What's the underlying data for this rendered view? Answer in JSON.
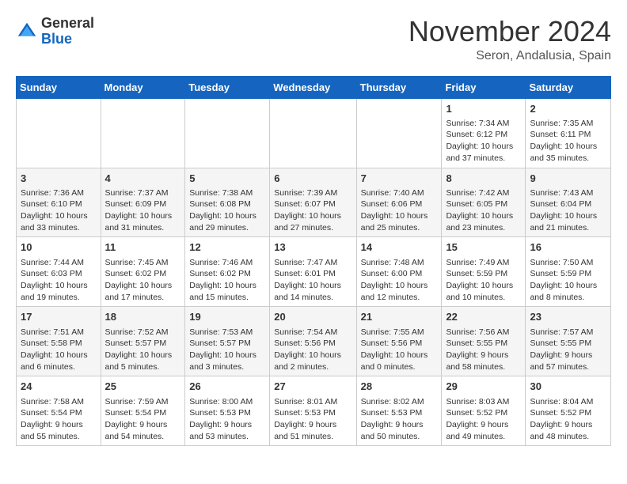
{
  "header": {
    "logo_general": "General",
    "logo_blue": "Blue",
    "month_title": "November 2024",
    "location": "Seron, Andalusia, Spain"
  },
  "weekdays": [
    "Sunday",
    "Monday",
    "Tuesday",
    "Wednesday",
    "Thursday",
    "Friday",
    "Saturday"
  ],
  "weeks": [
    [
      {
        "day": "",
        "content": ""
      },
      {
        "day": "",
        "content": ""
      },
      {
        "day": "",
        "content": ""
      },
      {
        "day": "",
        "content": ""
      },
      {
        "day": "",
        "content": ""
      },
      {
        "day": "1",
        "content": "Sunrise: 7:34 AM\nSunset: 6:12 PM\nDaylight: 10 hours and 37 minutes."
      },
      {
        "day": "2",
        "content": "Sunrise: 7:35 AM\nSunset: 6:11 PM\nDaylight: 10 hours and 35 minutes."
      }
    ],
    [
      {
        "day": "3",
        "content": "Sunrise: 7:36 AM\nSunset: 6:10 PM\nDaylight: 10 hours and 33 minutes."
      },
      {
        "day": "4",
        "content": "Sunrise: 7:37 AM\nSunset: 6:09 PM\nDaylight: 10 hours and 31 minutes."
      },
      {
        "day": "5",
        "content": "Sunrise: 7:38 AM\nSunset: 6:08 PM\nDaylight: 10 hours and 29 minutes."
      },
      {
        "day": "6",
        "content": "Sunrise: 7:39 AM\nSunset: 6:07 PM\nDaylight: 10 hours and 27 minutes."
      },
      {
        "day": "7",
        "content": "Sunrise: 7:40 AM\nSunset: 6:06 PM\nDaylight: 10 hours and 25 minutes."
      },
      {
        "day": "8",
        "content": "Sunrise: 7:42 AM\nSunset: 6:05 PM\nDaylight: 10 hours and 23 minutes."
      },
      {
        "day": "9",
        "content": "Sunrise: 7:43 AM\nSunset: 6:04 PM\nDaylight: 10 hours and 21 minutes."
      }
    ],
    [
      {
        "day": "10",
        "content": "Sunrise: 7:44 AM\nSunset: 6:03 PM\nDaylight: 10 hours and 19 minutes."
      },
      {
        "day": "11",
        "content": "Sunrise: 7:45 AM\nSunset: 6:02 PM\nDaylight: 10 hours and 17 minutes."
      },
      {
        "day": "12",
        "content": "Sunrise: 7:46 AM\nSunset: 6:02 PM\nDaylight: 10 hours and 15 minutes."
      },
      {
        "day": "13",
        "content": "Sunrise: 7:47 AM\nSunset: 6:01 PM\nDaylight: 10 hours and 14 minutes."
      },
      {
        "day": "14",
        "content": "Sunrise: 7:48 AM\nSunset: 6:00 PM\nDaylight: 10 hours and 12 minutes."
      },
      {
        "day": "15",
        "content": "Sunrise: 7:49 AM\nSunset: 5:59 PM\nDaylight: 10 hours and 10 minutes."
      },
      {
        "day": "16",
        "content": "Sunrise: 7:50 AM\nSunset: 5:59 PM\nDaylight: 10 hours and 8 minutes."
      }
    ],
    [
      {
        "day": "17",
        "content": "Sunrise: 7:51 AM\nSunset: 5:58 PM\nDaylight: 10 hours and 6 minutes."
      },
      {
        "day": "18",
        "content": "Sunrise: 7:52 AM\nSunset: 5:57 PM\nDaylight: 10 hours and 5 minutes."
      },
      {
        "day": "19",
        "content": "Sunrise: 7:53 AM\nSunset: 5:57 PM\nDaylight: 10 hours and 3 minutes."
      },
      {
        "day": "20",
        "content": "Sunrise: 7:54 AM\nSunset: 5:56 PM\nDaylight: 10 hours and 2 minutes."
      },
      {
        "day": "21",
        "content": "Sunrise: 7:55 AM\nSunset: 5:56 PM\nDaylight: 10 hours and 0 minutes."
      },
      {
        "day": "22",
        "content": "Sunrise: 7:56 AM\nSunset: 5:55 PM\nDaylight: 9 hours and 58 minutes."
      },
      {
        "day": "23",
        "content": "Sunrise: 7:57 AM\nSunset: 5:55 PM\nDaylight: 9 hours and 57 minutes."
      }
    ],
    [
      {
        "day": "24",
        "content": "Sunrise: 7:58 AM\nSunset: 5:54 PM\nDaylight: 9 hours and 55 minutes."
      },
      {
        "day": "25",
        "content": "Sunrise: 7:59 AM\nSunset: 5:54 PM\nDaylight: 9 hours and 54 minutes."
      },
      {
        "day": "26",
        "content": "Sunrise: 8:00 AM\nSunset: 5:53 PM\nDaylight: 9 hours and 53 minutes."
      },
      {
        "day": "27",
        "content": "Sunrise: 8:01 AM\nSunset: 5:53 PM\nDaylight: 9 hours and 51 minutes."
      },
      {
        "day": "28",
        "content": "Sunrise: 8:02 AM\nSunset: 5:53 PM\nDaylight: 9 hours and 50 minutes."
      },
      {
        "day": "29",
        "content": "Sunrise: 8:03 AM\nSunset: 5:52 PM\nDaylight: 9 hours and 49 minutes."
      },
      {
        "day": "30",
        "content": "Sunrise: 8:04 AM\nSunset: 5:52 PM\nDaylight: 9 hours and 48 minutes."
      }
    ]
  ]
}
